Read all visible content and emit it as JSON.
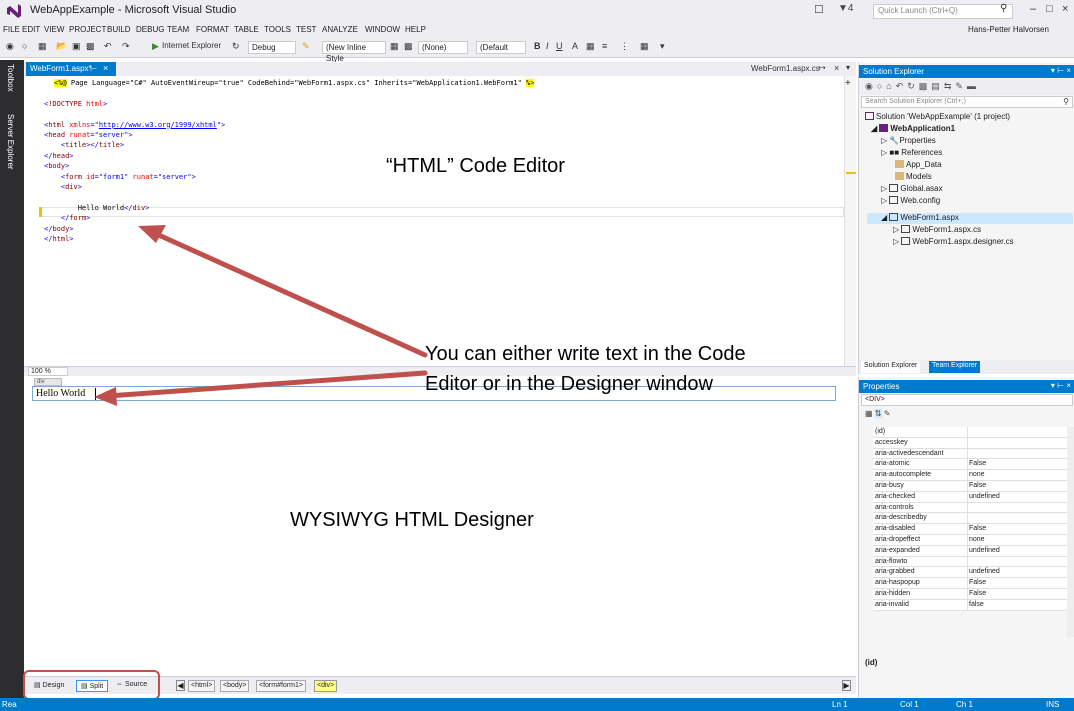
{
  "window": {
    "title": "WebAppExample - Microsoft Visual Studio",
    "notification_count": "4",
    "quick_launch_placeholder": "Quick Launch (Ctrl+Q)",
    "user": "Hans-Petter Halvorsen"
  },
  "menu": [
    "FILE",
    "EDIT",
    "VIEW",
    "PROJECT",
    "BUILD",
    "DEBUG",
    "TEAM",
    "FORMAT",
    "TABLE",
    "TOOLS",
    "TEST",
    "ANALYZE",
    "WINDOW",
    "HELP"
  ],
  "toolbar": {
    "browser": "Internet Explorer",
    "config": "Debug",
    "style": "(New Inline Style",
    "target": "(None)",
    "font": "(Default"
  },
  "side_tabs": [
    "Toolbox",
    "Server Explorer"
  ],
  "editor": {
    "tab_title": "WebForm1.aspx*",
    "preview_tab": "WebForm1.aspx.cs",
    "zoom": "100 %",
    "lines": [
      {
        "dir": "<%@",
        "rest": " Page Language=\"C#\" AutoEventWireup=\"true\" CodeBehind=\"WebForm1.aspx.cs\" Inherits=\"WebApplication1.WebForm1\" ",
        "end": "%>"
      },
      {
        "text": ""
      },
      {
        "text": "<!DOCTYPE html>"
      },
      {
        "text": ""
      },
      {
        "text": "<html xmlns=\"http://www.w3.org/1999/xhtml\">"
      },
      {
        "text": "<head runat=\"server\">"
      },
      {
        "text": "    <title></title>"
      },
      {
        "text": "</head>"
      },
      {
        "text": "<body>"
      },
      {
        "text": "    <form id=\"form1\" runat=\"server\">"
      },
      {
        "text": "    <div>"
      },
      {
        "text": ""
      },
      {
        "text": "        Hello World</div>"
      },
      {
        "text": "    </form>"
      },
      {
        "text": "</body>"
      },
      {
        "text": "</html>"
      }
    ]
  },
  "designer": {
    "div_label": "div",
    "content": "Hello World"
  },
  "view_tabs": {
    "design": "Design",
    "split": "Split",
    "source": "Source",
    "breadcrumbs": [
      "<html>",
      "<body>",
      "<form#form1>",
      "<div>"
    ]
  },
  "status": {
    "ready": "Rea",
    "ln": "Ln 1",
    "col": "Col 1",
    "ch": "Ch 1",
    "mode": "INS"
  },
  "solution_explorer": {
    "title": "Solution Explorer",
    "search_placeholder": "Search Solution Explorer (Ctrl+;)",
    "items": [
      {
        "label": "Solution 'WebAppExample' (1 project)",
        "level": 0,
        "bold": false
      },
      {
        "label": "WebApplication1",
        "level": 1,
        "bold": true
      },
      {
        "label": "Properties",
        "level": 2,
        "bold": false
      },
      {
        "label": "References",
        "level": 2,
        "bold": false
      },
      {
        "label": "App_Data",
        "level": 2,
        "bold": false
      },
      {
        "label": "Models",
        "level": 2,
        "bold": false
      },
      {
        "label": "Global.asax",
        "level": 2,
        "bold": false
      },
      {
        "label": "Web.config",
        "level": 2,
        "bold": false
      },
      {
        "label": "WebForm1.aspx",
        "level": 2,
        "bold": false
      },
      {
        "label": "WebForm1.aspx.cs",
        "level": 3,
        "bold": false
      },
      {
        "label": "WebForm1.aspx.designer.cs",
        "level": 3,
        "bold": false
      }
    ],
    "tabs": [
      "Solution Explorer",
      "Team Explorer"
    ]
  },
  "properties": {
    "title": "Properties",
    "object": "<DIV>",
    "rows": [
      {
        "name": "(id)",
        "value": ""
      },
      {
        "name": "accesskey",
        "value": ""
      },
      {
        "name": "aria-activedescendant",
        "value": ""
      },
      {
        "name": "aria-atomic",
        "value": "False"
      },
      {
        "name": "aria-autocomplete",
        "value": "none"
      },
      {
        "name": "aria-busy",
        "value": "False"
      },
      {
        "name": "aria-checked",
        "value": "undefined"
      },
      {
        "name": "aria-controls",
        "value": ""
      },
      {
        "name": "aria-describedby",
        "value": ""
      },
      {
        "name": "aria-disabled",
        "value": "False"
      },
      {
        "name": "aria-dropeffect",
        "value": "none"
      },
      {
        "name": "aria-expanded",
        "value": "undefined"
      },
      {
        "name": "aria-flowto",
        "value": ""
      },
      {
        "name": "aria-grabbed",
        "value": "undefined"
      },
      {
        "name": "aria-haspopup",
        "value": "False"
      },
      {
        "name": "aria-hidden",
        "value": "False"
      },
      {
        "name": "aria-invalid",
        "value": "false"
      }
    ],
    "description": "(id)"
  },
  "annotations": {
    "code_editor": "“HTML” Code Editor",
    "either_line1": "You can either write text in the Code",
    "either_line2": "Editor or in the Designer window",
    "designer": "WYSIWYG  HTML Designer"
  },
  "colors": {
    "accent": "#007acc",
    "annotation_red": "#c0504d"
  }
}
